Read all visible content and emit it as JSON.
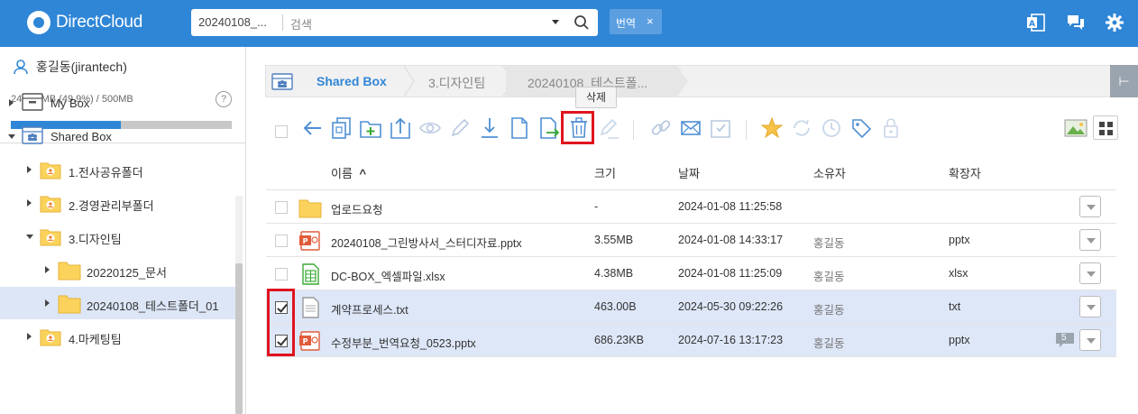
{
  "brand": {
    "name": "DirectCloud"
  },
  "search": {
    "folder_value": "20240108_...",
    "placeholder": "검색"
  },
  "tag": {
    "label": "번역",
    "close": "×"
  },
  "top_icons": [
    "office-icon",
    "chat-icon",
    "gear-icon"
  ],
  "user": {
    "name": "홍길동(jirantech)",
    "quota": "249.56MB (49.9%) / 500MB",
    "usage_fraction": 0.499,
    "help": "?"
  },
  "tree": [
    {
      "label": "My Box",
      "expanded": false
    },
    {
      "label": "Shared Box",
      "expanded": true
    },
    {
      "label": "1.전사공유폴더",
      "expanded": false
    },
    {
      "label": "2.경영관리부폴더",
      "expanded": false
    },
    {
      "label": "3.디자인팀",
      "expanded": true
    },
    {
      "label": "20220125_문서",
      "expanded": false
    },
    {
      "label": "20240108_테스트폴더_01",
      "expanded": false,
      "selected": true
    },
    {
      "label": "4.마케팅팀",
      "expanded": false
    }
  ],
  "breadcrumb": [
    "Shared Box",
    "3.디자인팀",
    "20240108_테스트폴..."
  ],
  "tooltip": "삭제",
  "collapse_glyph": "⊢",
  "table": {
    "headers": {
      "name": "이름",
      "sort": "^",
      "size": "크기",
      "date": "날짜",
      "owner": "소유자",
      "ext": "확장자"
    },
    "rows": [
      {
        "name": "업로드요청",
        "size": "-",
        "date": "2024-01-08 11:25:58",
        "owner": "",
        "ext": "",
        "type": "folder",
        "checked": false
      },
      {
        "name": "20240108_그린방사서_스터디자료.pptx",
        "size": "3.55MB",
        "date": "2024-01-08 14:33:17",
        "owner": "홍길동",
        "ext": "pptx",
        "type": "pptx",
        "checked": false
      },
      {
        "name": "DC-BOX_엑셀파일.xlsx",
        "size": "4.38MB",
        "date": "2024-01-08 11:25:09",
        "owner": "홍길동",
        "ext": "xlsx",
        "type": "xlsx",
        "checked": false
      },
      {
        "name": "계약프로세스.txt",
        "size": "463.00B",
        "date": "2024-05-30 09:22:26",
        "owner": "홍길동",
        "ext": "txt",
        "type": "txt",
        "checked": true
      },
      {
        "name": "수정부분_번역요청_0523.pptx",
        "size": "686.23KB",
        "date": "2024-07-16 13:17:23",
        "owner": "홍길동",
        "ext": "pptx",
        "type": "pptx",
        "checked": true,
        "comments": "5"
      }
    ]
  },
  "colors": {
    "brand_blue": "#2f86d6",
    "highlight_red": "#e0141e",
    "selected_row": "#dee7f8"
  }
}
